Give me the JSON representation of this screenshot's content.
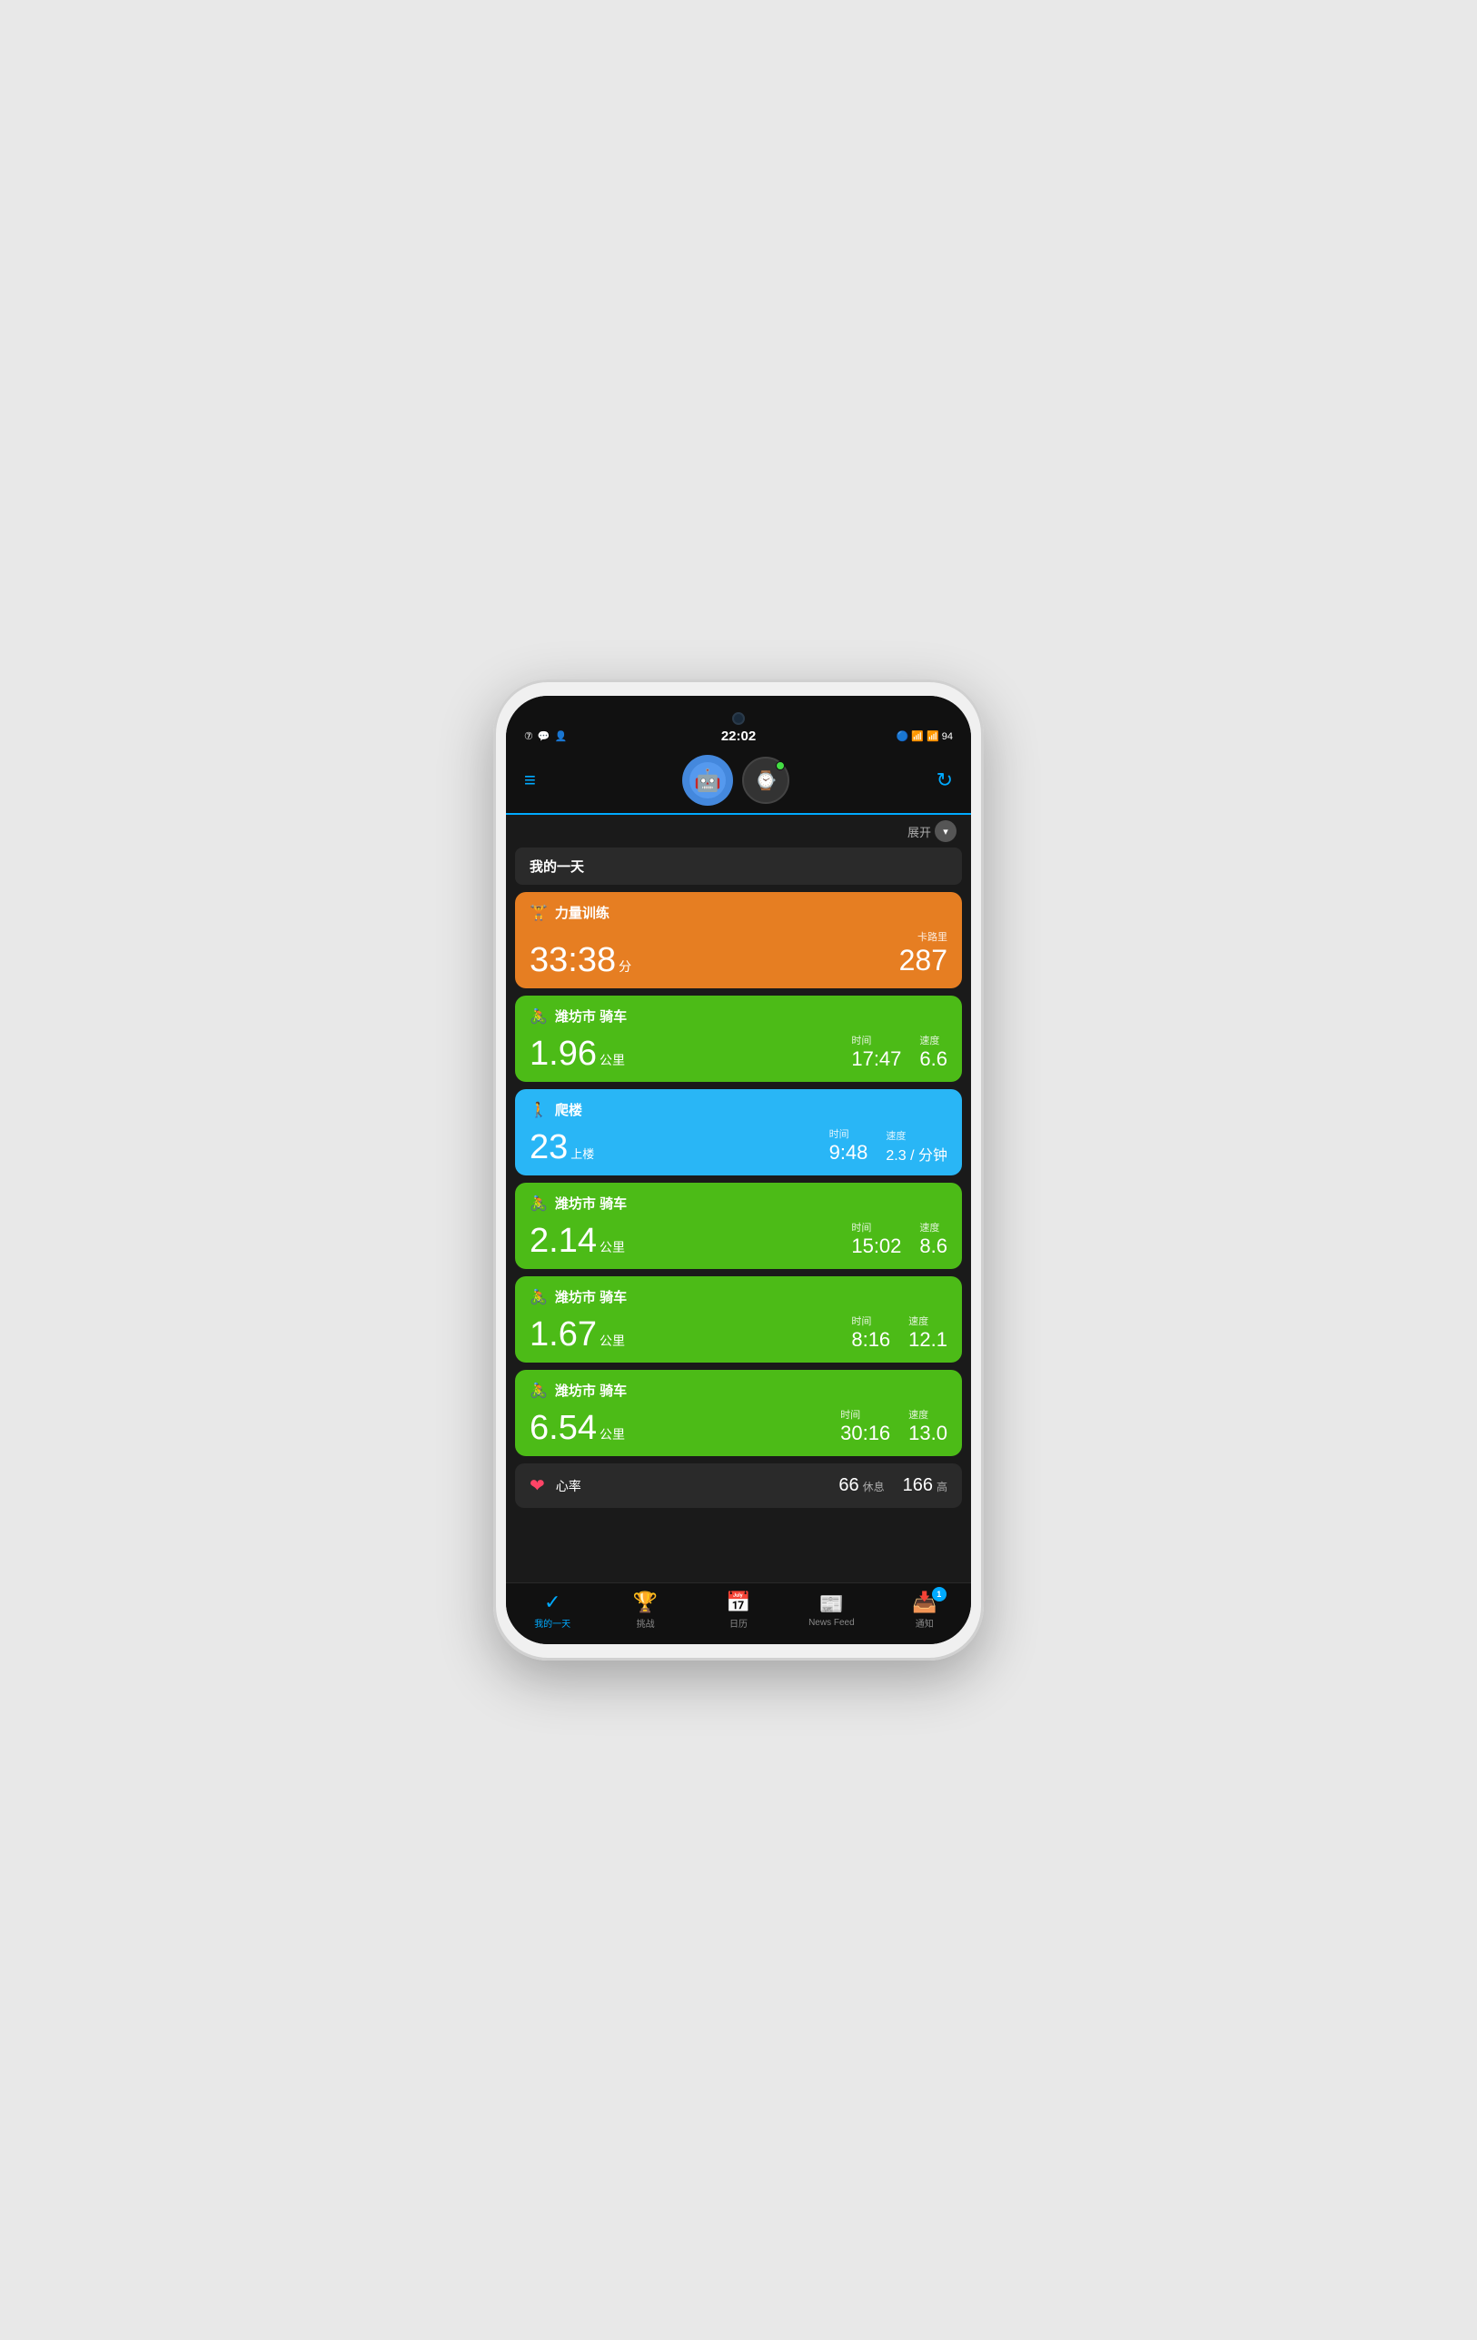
{
  "status_bar": {
    "time": "22:02",
    "battery": "94",
    "notifications": "7"
  },
  "header": {
    "menu_icon": "≡",
    "refresh_icon": "↻"
  },
  "expand": {
    "label": "展开",
    "icon": "▾"
  },
  "section": {
    "title": "我的一天"
  },
  "activities": [
    {
      "id": "strength",
      "color": "orange",
      "icon": "🏋",
      "title": "力量训练",
      "main_value": "33:38",
      "main_unit": "分",
      "calories_label": "卡路里",
      "calories_value": "287",
      "stats": []
    },
    {
      "id": "cycling1",
      "color": "green",
      "icon": "🚴",
      "title": "潍坊市 骑车",
      "main_value": "1.96",
      "main_unit": "公里",
      "stats": [
        {
          "label": "时间",
          "value": "17:47"
        },
        {
          "label": "速度",
          "value": "6.6"
        }
      ]
    },
    {
      "id": "stairs",
      "color": "blue",
      "icon": "🚶",
      "title": "爬楼",
      "main_value": "23",
      "main_unit": "上楼",
      "stats": [
        {
          "label": "时间",
          "value": "9:48"
        },
        {
          "label": "速度",
          "value": "2.3 / 分钟"
        }
      ]
    },
    {
      "id": "cycling2",
      "color": "green",
      "icon": "🚴",
      "title": "潍坊市 骑车",
      "main_value": "2.14",
      "main_unit": "公里",
      "stats": [
        {
          "label": "时间",
          "value": "15:02"
        },
        {
          "label": "速度",
          "value": "8.6"
        }
      ]
    },
    {
      "id": "cycling3",
      "color": "green",
      "icon": "🚴",
      "title": "潍坊市 骑车",
      "main_value": "1.67",
      "main_unit": "公里",
      "stats": [
        {
          "label": "时间",
          "value": "8:16"
        },
        {
          "label": "速度",
          "value": "12.1"
        }
      ]
    },
    {
      "id": "cycling4",
      "color": "green",
      "icon": "🚴",
      "title": "潍坊市 骑车",
      "main_value": "6.54",
      "main_unit": "公里",
      "stats": [
        {
          "label": "时间",
          "value": "30:16"
        },
        {
          "label": "速度",
          "value": "13.0"
        }
      ]
    }
  ],
  "heart_rate": {
    "label": "心率",
    "resting_value": "66",
    "resting_label": "休息",
    "high_value": "166",
    "high_label": "高"
  },
  "bottom_nav": [
    {
      "id": "my-day",
      "icon": "✓",
      "label": "我的一天",
      "active": true,
      "badge": null
    },
    {
      "id": "challenges",
      "icon": "🏆",
      "label": "挑战",
      "active": false,
      "badge": null
    },
    {
      "id": "calendar",
      "icon": "📅",
      "label": "日历",
      "active": false,
      "badge": null
    },
    {
      "id": "news-feed",
      "icon": "📰",
      "label": "News Feed",
      "active": false,
      "badge": null
    },
    {
      "id": "notifications",
      "icon": "📥",
      "label": "通知",
      "active": false,
      "badge": "1"
    }
  ]
}
